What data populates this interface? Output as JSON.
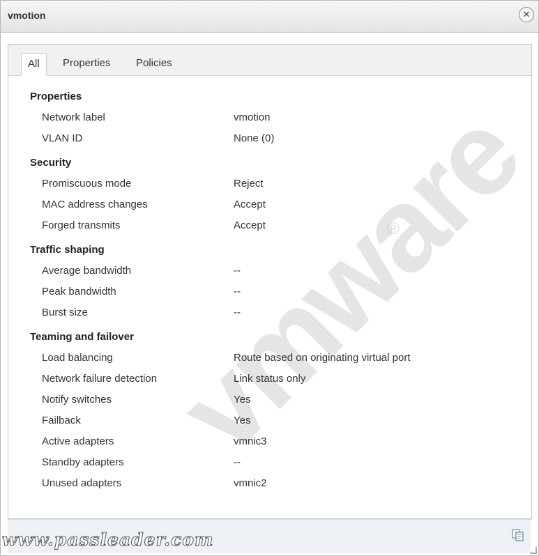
{
  "window": {
    "title": "vmotion"
  },
  "tabs": [
    {
      "label": "All",
      "active": true
    },
    {
      "label": "Properties",
      "active": false
    },
    {
      "label": "Policies",
      "active": false
    }
  ],
  "sections": {
    "properties": {
      "title": "Properties",
      "rows": [
        {
          "label": "Network label",
          "value": "vmotion"
        },
        {
          "label": "VLAN ID",
          "value": "None (0)"
        }
      ]
    },
    "security": {
      "title": "Security",
      "rows": [
        {
          "label": "Promiscuous mode",
          "value": "Reject"
        },
        {
          "label": "MAC address changes",
          "value": "Accept"
        },
        {
          "label": "Forged transmits",
          "value": "Accept"
        }
      ]
    },
    "traffic_shaping": {
      "title": "Traffic shaping",
      "rows": [
        {
          "label": "Average bandwidth",
          "value": "--"
        },
        {
          "label": "Peak bandwidth",
          "value": "--"
        },
        {
          "label": "Burst size",
          "value": "--"
        }
      ]
    },
    "teaming": {
      "title": "Teaming and failover",
      "rows": [
        {
          "label": "Load balancing",
          "value": "Route based on originating virtual port"
        },
        {
          "label": "Network failure detection",
          "value": "Link status only"
        },
        {
          "label": "Notify switches",
          "value": "Yes"
        },
        {
          "label": "Failback",
          "value": "Yes"
        },
        {
          "label": "Active adapters",
          "value": "vmnic3"
        },
        {
          "label": "Standby adapters",
          "value": "--"
        },
        {
          "label": "Unused adapters",
          "value": "vmnic2"
        }
      ]
    }
  },
  "watermark": {
    "brand": "vmware",
    "site": "www.passleader.com"
  },
  "icons": {
    "close": "close-icon",
    "copy": "copy-icon"
  }
}
